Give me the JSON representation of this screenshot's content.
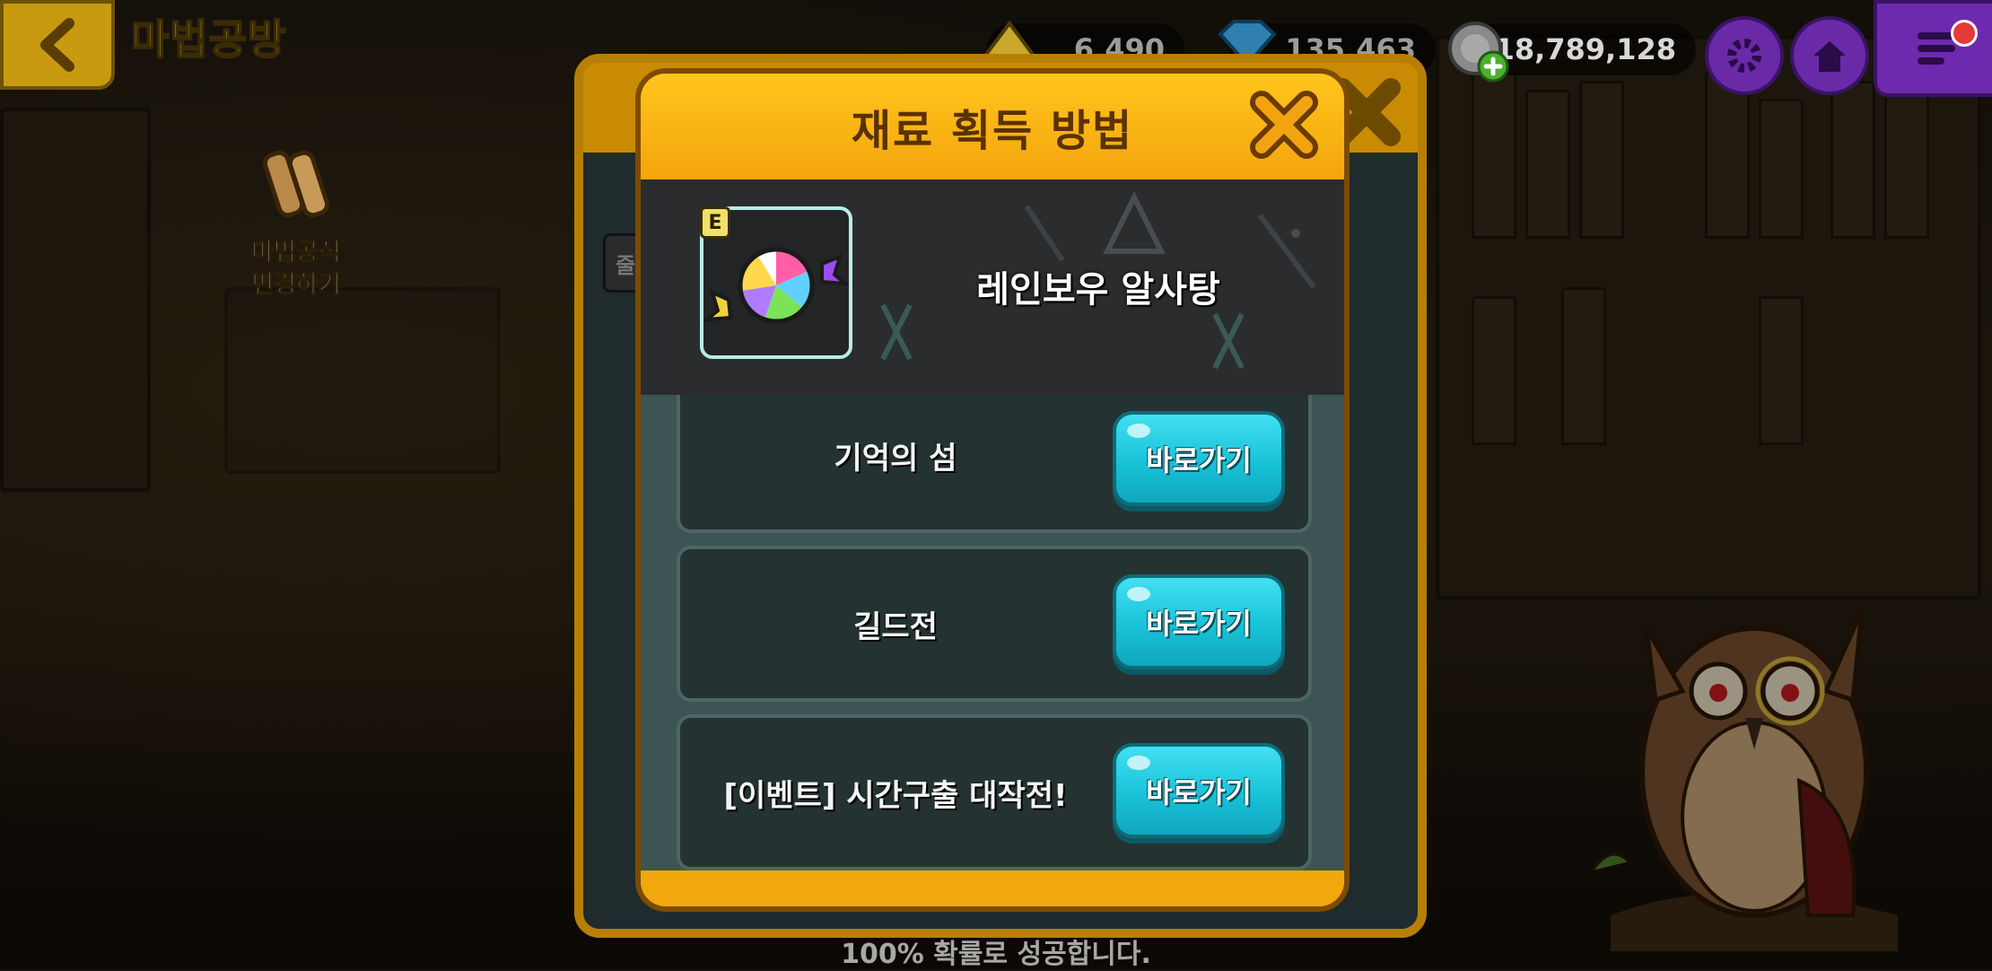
{
  "top_bar": {
    "title": "마법공방",
    "resources": {
      "crystal_partial": "6,490",
      "gem_partial": "135,463",
      "coins": "418,789,128"
    }
  },
  "side_menu": {
    "recipe_change_line1": "마법공식",
    "recipe_change_line2": "변경하기"
  },
  "background": {
    "bottom_note": "100% 확률로 성공합니다.",
    "partial_button_char": "줄"
  },
  "popup": {
    "title": "재료 획득 방법",
    "item": {
      "grade": "E",
      "name": "레인보우 알사탕"
    },
    "sources": [
      {
        "label": "기억의 섬",
        "button": "바로가기"
      },
      {
        "label": "길드전",
        "button": "바로가기"
      },
      {
        "label": "[이벤트] 시간구출 대작전!",
        "button": "바로가기"
      }
    ]
  },
  "colors": {
    "accent_orange": "#f4a50c",
    "button_cyan": "#18c2d8",
    "menu_purple": "#6d2aae"
  }
}
